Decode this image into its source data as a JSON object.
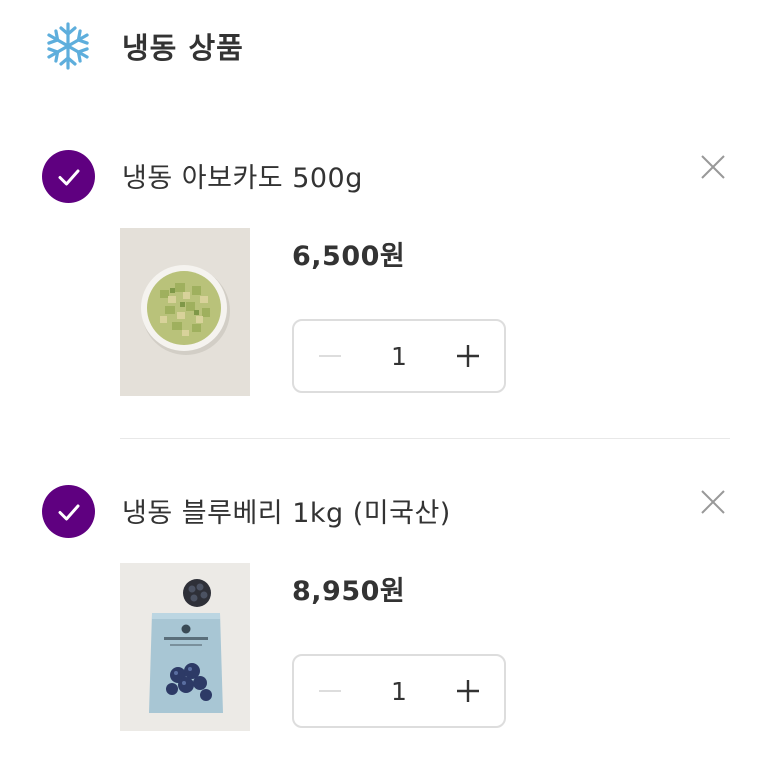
{
  "section": {
    "icon": "snowflake-icon",
    "title": "냉동 상품"
  },
  "theme": {
    "accent": "#5f0080",
    "icon_blue": "#5eaedc",
    "text": "#333333",
    "border": "#dddddd"
  },
  "items": [
    {
      "checked": true,
      "name": "냉동 아보카도 500g",
      "price": "6,500원",
      "quantity": "1",
      "image": "frozen-avocado-bowl-image"
    },
    {
      "checked": true,
      "name": "냉동 블루베리 1kg (미국산)",
      "price": "8,950원",
      "quantity": "1",
      "image": "frozen-blueberry-bag-image"
    }
  ]
}
